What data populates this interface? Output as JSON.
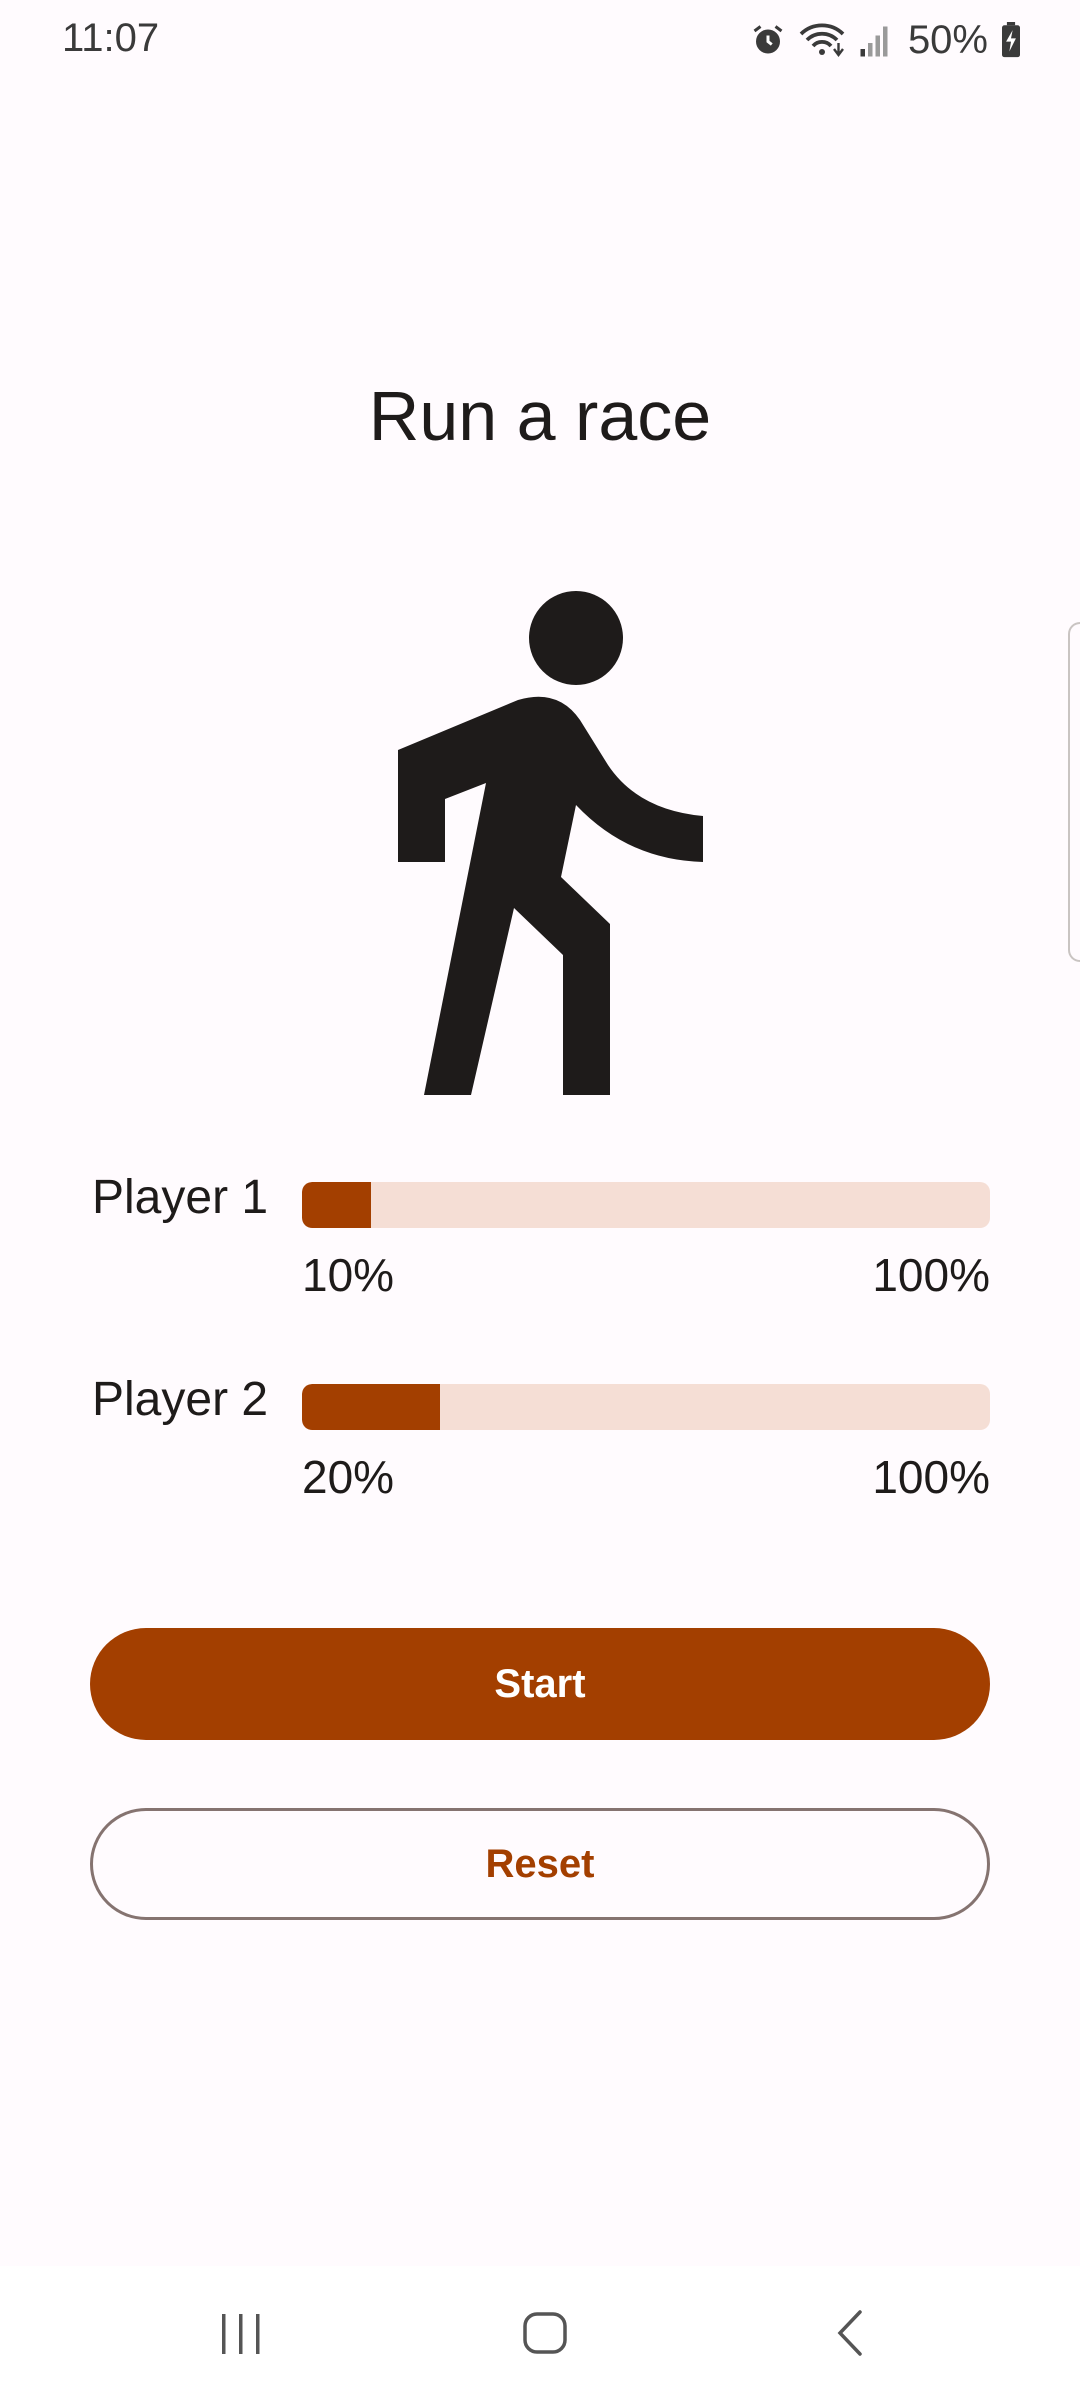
{
  "status_bar": {
    "time": "11:07",
    "battery": "50%",
    "icons": [
      "alarm-icon",
      "wifi-icon",
      "signal-icon",
      "battery-charging-icon"
    ]
  },
  "screen": {
    "title": "Run a race",
    "hero_icon": "walking-person-icon"
  },
  "players": [
    {
      "label": "Player 1",
      "progress_fraction": 0.1,
      "progress_text": "10%",
      "max_text": "100%"
    },
    {
      "label": "Player 2",
      "progress_fraction": 0.2,
      "progress_text": "20%",
      "max_text": "100%"
    }
  ],
  "buttons": {
    "start_label": "Start",
    "reset_label": "Reset"
  },
  "colors": {
    "primary": "#A33F00",
    "track": "#F5DED5",
    "background": "#FFFBFE",
    "outline": "#857370"
  },
  "nav_bar": {
    "icons": [
      "recents-icon",
      "home-icon",
      "back-icon"
    ]
  }
}
